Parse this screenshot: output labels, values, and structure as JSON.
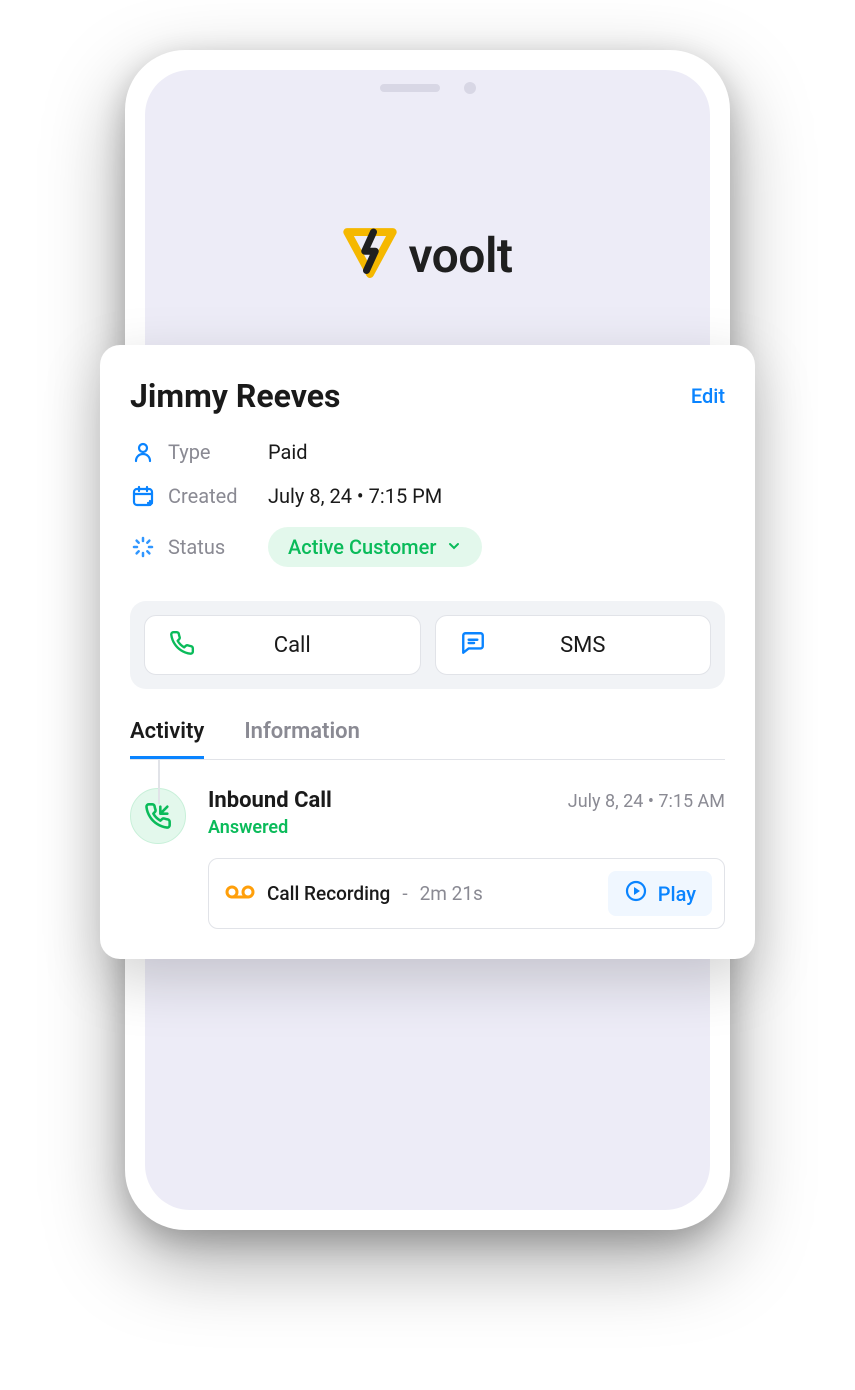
{
  "brand": {
    "name": "voolt"
  },
  "card": {
    "title": "Jimmy Reeves",
    "edit_label": "Edit",
    "rows": {
      "type": {
        "label": "Type",
        "value": "Paid"
      },
      "created": {
        "label": "Created",
        "value": "July 8, 24 • 7:15 PM"
      },
      "status": {
        "label": "Status",
        "pill": "Active Customer"
      }
    },
    "actions": {
      "call": "Call",
      "sms": "SMS"
    },
    "tabs": {
      "activity": "Activity",
      "information": "Information"
    }
  },
  "activity": {
    "item": {
      "title": "Inbound Call",
      "timestamp": "July 8, 24 • 7:15 AM",
      "status": "Answered",
      "recording": {
        "label": "Call Recording",
        "separator": "-",
        "duration": "2m 21s",
        "play_label": "Play"
      }
    }
  }
}
